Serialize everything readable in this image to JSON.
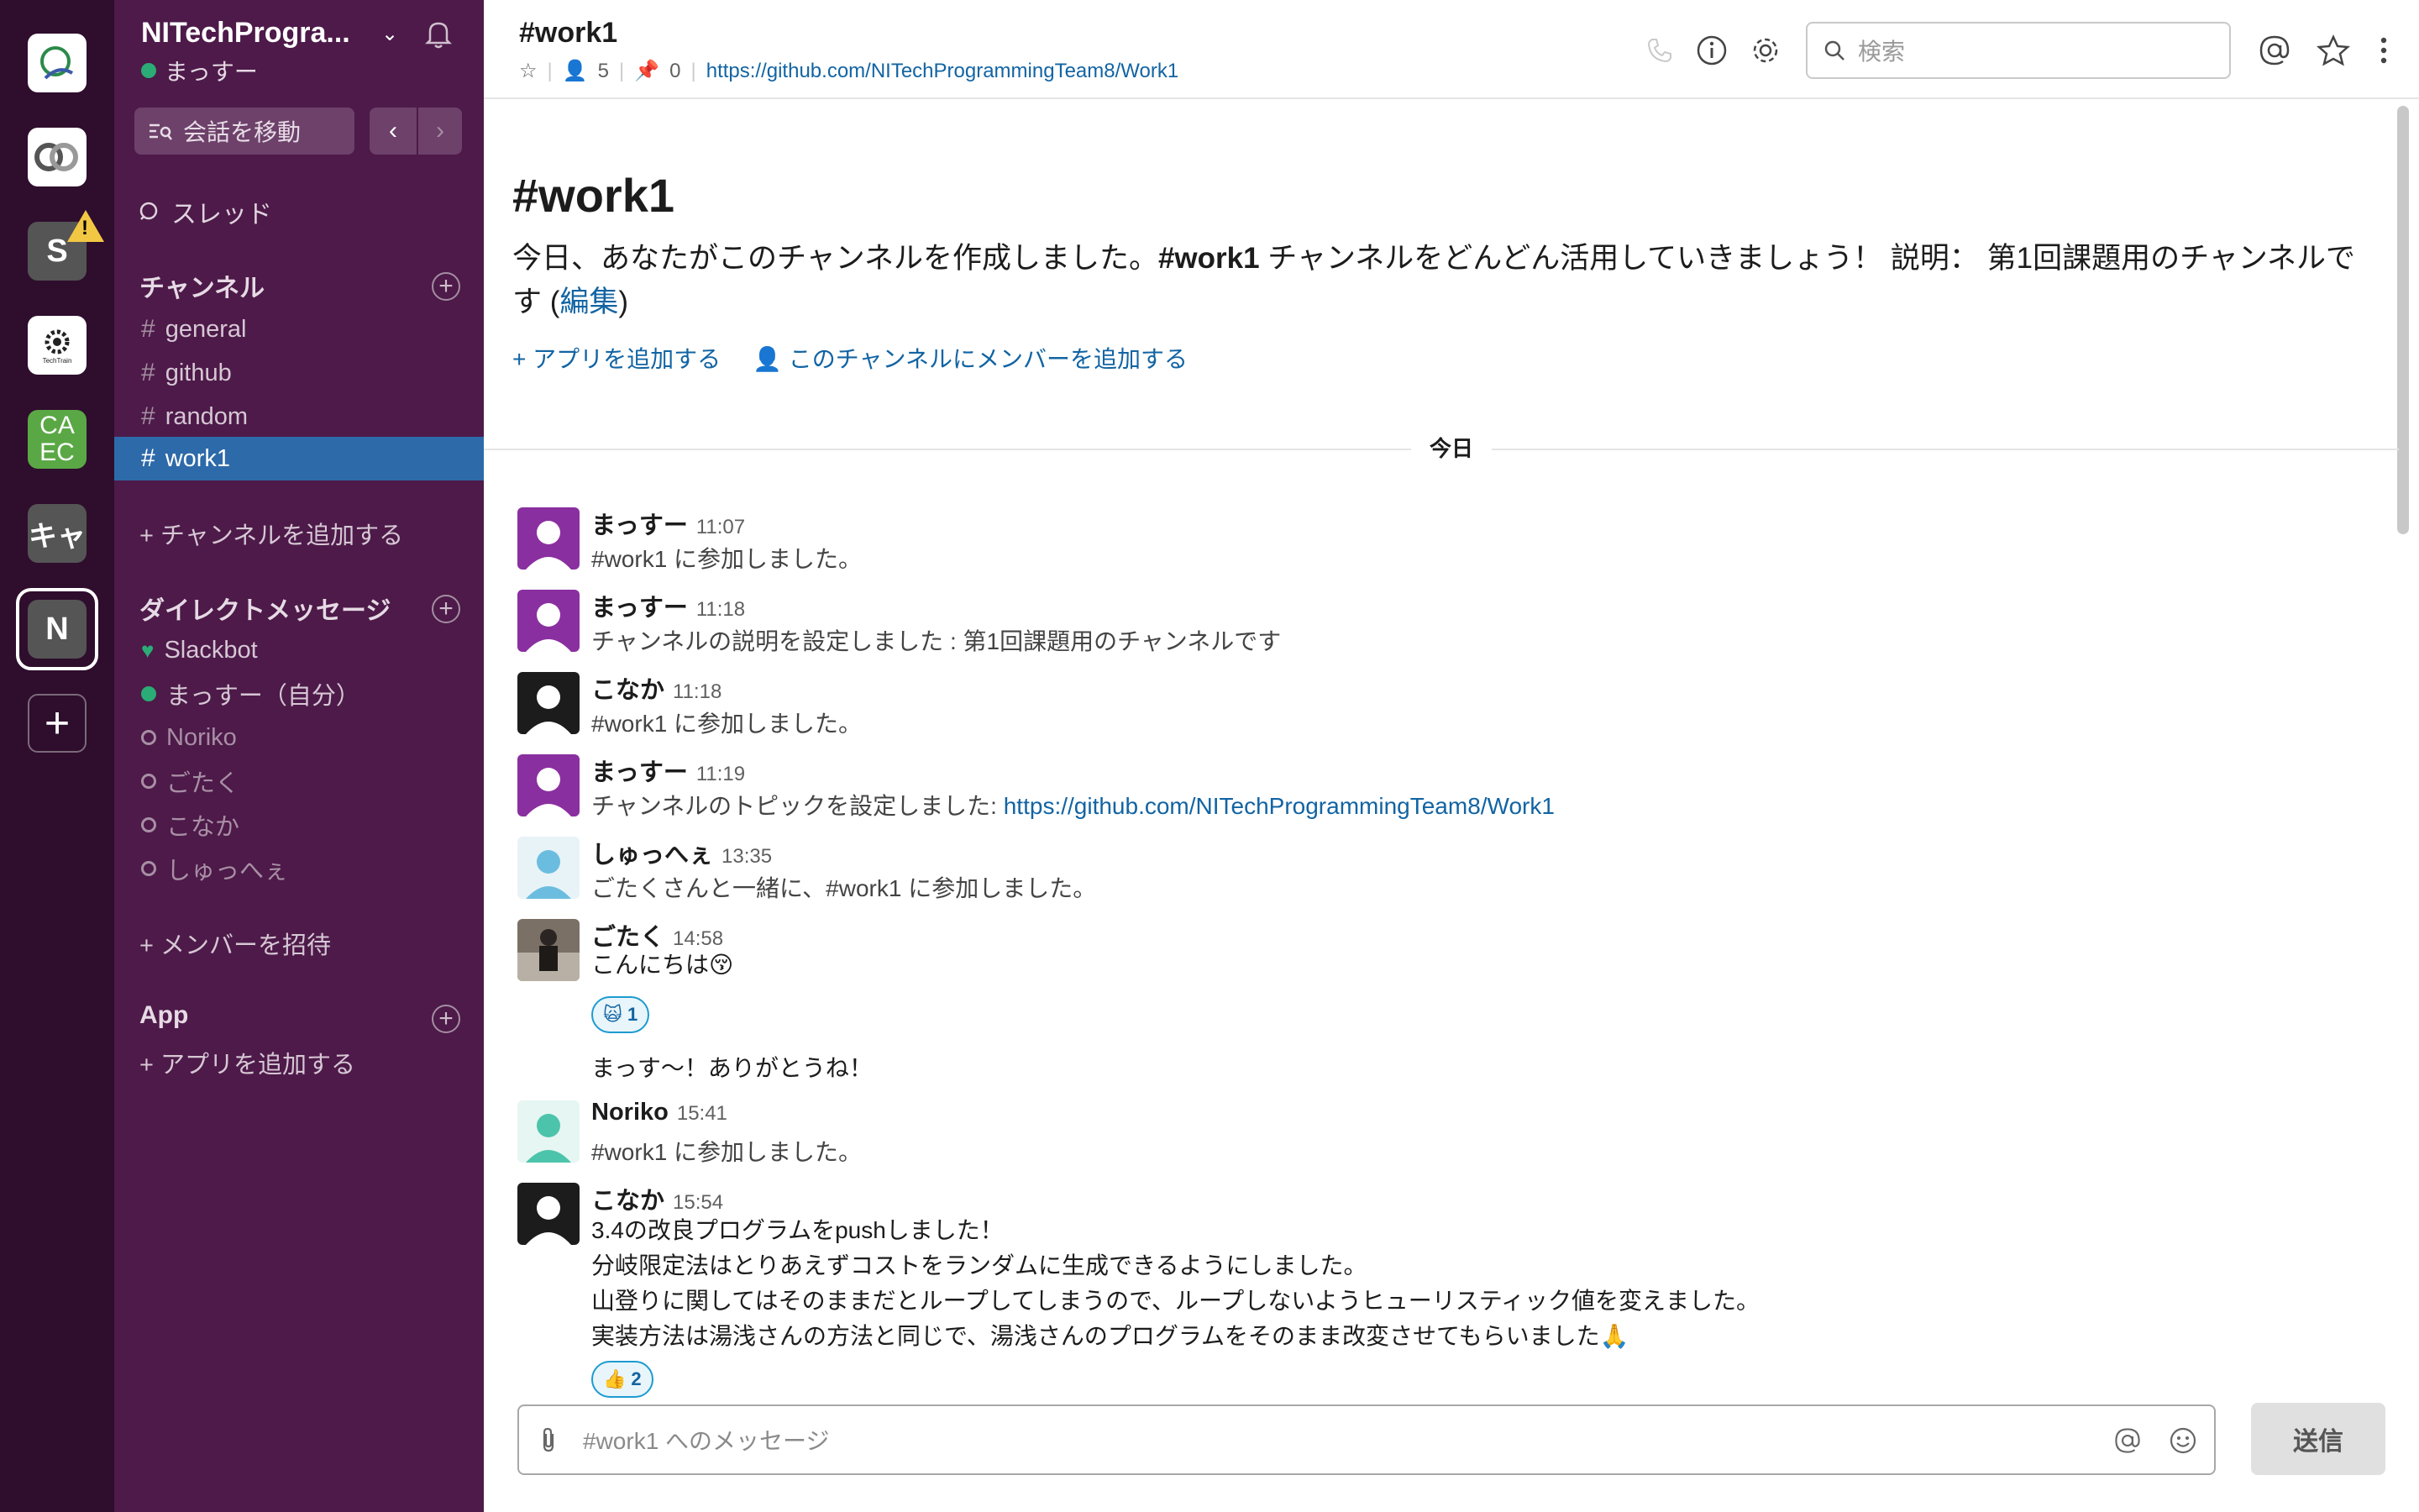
{
  "workspaces": [
    {
      "name": "workspace-1",
      "icon": "q-logo-icon"
    },
    {
      "name": "workspace-2",
      "icon": "co-logo-icon"
    },
    {
      "name": "S",
      "letter": "S",
      "warning": "!"
    },
    {
      "name": "techtrain",
      "icon": "techtrain-logo-icon",
      "text": "TechTrain"
    },
    {
      "name": "CAEC",
      "letter1": "CA",
      "letter2": "EC"
    },
    {
      "name": "キャ",
      "letter": "キャ"
    },
    {
      "name": "N",
      "letter": "N"
    }
  ],
  "sidebar": {
    "team_name": "NITechProgra...",
    "user_name": "まっすー",
    "jump_label": "会話を移動",
    "threads_label": "スレッド",
    "channels_header": "チャンネル",
    "channels": [
      {
        "name": "general"
      },
      {
        "name": "github"
      },
      {
        "name": "random"
      },
      {
        "name": "work1"
      }
    ],
    "add_channel": "+ チャンネルを追加する",
    "dm_header": "ダイレクトメッセージ",
    "dms": [
      {
        "name": "Slackbot"
      },
      {
        "name": "まっすー（自分）"
      },
      {
        "name": "Noriko"
      },
      {
        "name": "ごたく"
      },
      {
        "name": "こなか"
      },
      {
        "name": "しゅっへぇ"
      }
    ],
    "invite": "+ メンバーを招待",
    "apps_header": "App",
    "add_app": "+ アプリを追加する"
  },
  "header": {
    "channel_title": "#work1",
    "member_count": "5",
    "pin_count": "0",
    "topic_link": "https://github.com/NITechProgrammingTeam8/Work1",
    "search_placeholder": "検索"
  },
  "intro": {
    "title": "#work1",
    "desc_part1": "今日、あなたがこのチャンネルを作成しました。",
    "desc_channel": "#work1",
    "desc_part2": " チャンネルをどんどん活用していきましょう！ 説明： 第1回課題用のチャンネルです (",
    "desc_edit": "編集",
    "desc_close": ")",
    "add_app": "+ アプリを追加する",
    "add_member": "このチャンネルにメンバーを追加する"
  },
  "day_divider": "今日",
  "messages": [
    {
      "author": "まっすー",
      "time": "11:07",
      "text": "#work1 に参加しました。"
    },
    {
      "author": "まっすー",
      "time": "11:18",
      "text": "チャンネルの説明を設定しました : 第1回課題用のチャンネルです"
    },
    {
      "author": "こなか",
      "time": "11:18",
      "text": "#work1 に参加しました。"
    },
    {
      "author": "まっすー",
      "time": "11:19",
      "text": "チャンネルのトピックを設定しました: ",
      "link": "https://github.com/NITechProgrammingTeam8/Work1"
    },
    {
      "author": "しゅっへぇ",
      "time": "13:35",
      "text": "ごたくさんと一緒に、#work1 に参加しました。"
    },
    {
      "author": "ごたく",
      "time": "14:58",
      "text": "こんにちは😚",
      "reaction_emoji": "🙀",
      "reaction_count": "1",
      "followup": "まっす〜！ありがとうね！"
    },
    {
      "author": "Noriko",
      "time": "15:41",
      "text": "#work1 に参加しました。"
    },
    {
      "author": "こなか",
      "time": "15:54",
      "lines": [
        "3.4の改良プログラムをpushしました！",
        "分岐限定法はとりあえずコストをランダムに生成できるようにしました。",
        "山登りに関してはそのままだとループしてしまうので、ループしないようヒューリスティック値を変えました。",
        "実装方法は湯浅さんの方法と同じで、湯浅さんのプログラムをそのまま改変させてもらいました🙏"
      ],
      "reaction_emoji": "👍",
      "reaction_count": "2"
    }
  ],
  "composer": {
    "placeholder": "#work1 へのメッセージ",
    "send_label": "送信"
  },
  "colors": {
    "rail": "#2f0d2d",
    "sidebar": "#4d1a49",
    "active_channel": "#2d6aa9",
    "link": "#1264a3",
    "online": "#2bac76"
  }
}
